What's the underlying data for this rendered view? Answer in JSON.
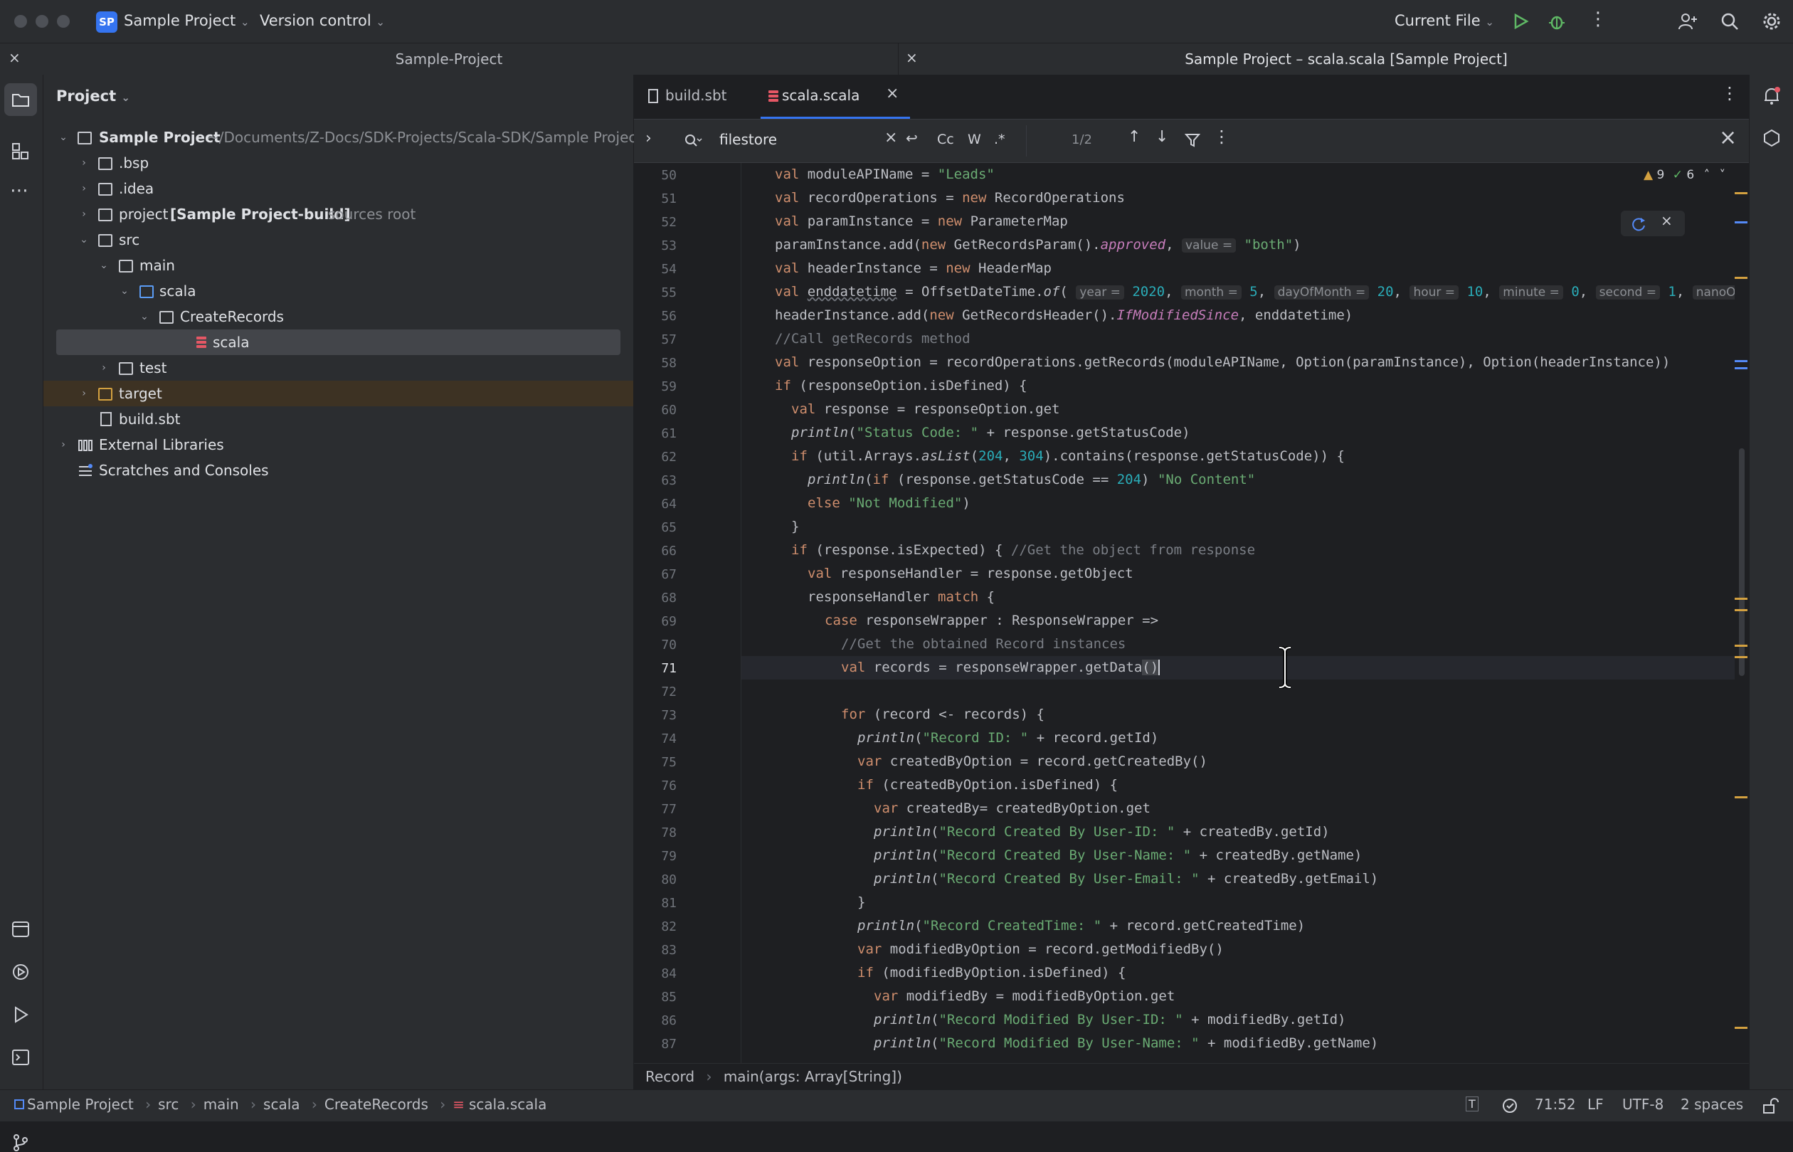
{
  "titlebar": {
    "badge": "SP",
    "project": "Sample Project",
    "vcs": "Version control",
    "run_config": "Current File"
  },
  "window_tabs": {
    "left": "Sample-Project",
    "right": "Sample Project – scala.scala [Sample Project]"
  },
  "project_panel": {
    "title": "Project",
    "tree": [
      {
        "label": "Sample Project",
        "extra": "~/Documents/Z-Docs/SDK-Projects/Scala-SDK/Sample Project"
      },
      {
        "label": ".bsp"
      },
      {
        "label": ".idea"
      },
      {
        "label": "project",
        "bold": "[Sample Project-build]",
        "extra": "sources root"
      },
      {
        "label": "src"
      },
      {
        "label": "main"
      },
      {
        "label": "scala"
      },
      {
        "label": "CreateRecords"
      },
      {
        "label": "scala"
      },
      {
        "label": "test"
      },
      {
        "label": "target"
      },
      {
        "label": "build.sbt"
      },
      {
        "label": "External Libraries"
      },
      {
        "label": "Scratches and Consoles"
      }
    ]
  },
  "editor": {
    "tabs": [
      "build.sbt",
      "scala.scala"
    ],
    "find": {
      "query": "filestore",
      "case": "Cc",
      "word": "W",
      "regex": ".*",
      "count": "1/2"
    },
    "inspections": {
      "warnings": "9",
      "ok": "6"
    },
    "line_numbers": [
      "50",
      "51",
      "52",
      "53",
      "54",
      "55",
      "56",
      "57",
      "58",
      "59",
      "60",
      "61",
      "62",
      "63",
      "64",
      "65",
      "66",
      "67",
      "68",
      "69",
      "70",
      "71",
      "72",
      "73",
      "74",
      "75",
      "76",
      "77",
      "78",
      "79",
      "80",
      "81",
      "82",
      "83",
      "84",
      "85",
      "86",
      "87"
    ],
    "current_line": "71",
    "breadcrumb": [
      "Record",
      "main(args: Array[String])"
    ]
  },
  "statusbar": {
    "path": [
      "Sample Project",
      "src",
      "main",
      "scala",
      "CreateRecords",
      "scala.scala"
    ],
    "position": "71:52",
    "line_sep": "LF",
    "encoding": "UTF-8",
    "indent": "2 spaces"
  }
}
